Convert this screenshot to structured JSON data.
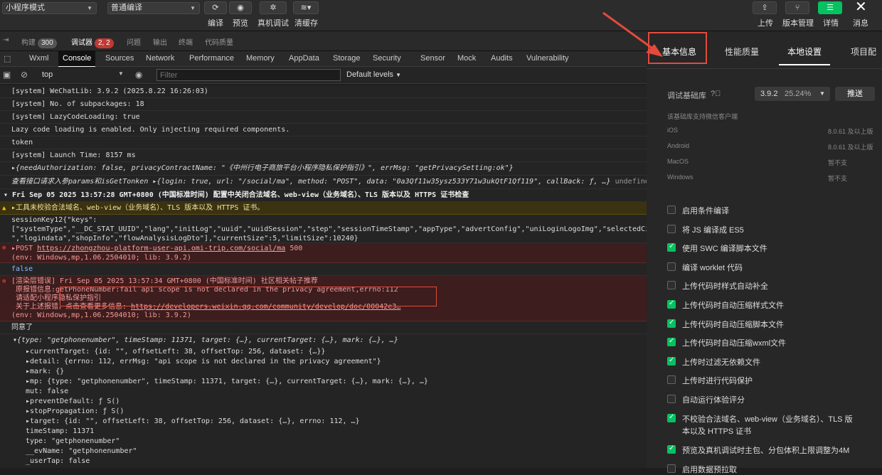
{
  "toolbar": {
    "mode_select": "小程序模式",
    "compile_select": "普通编译",
    "labels": {
      "compile": "编译",
      "preview": "预览",
      "remote_debug": "真机调试",
      "clear_cache": "清缓存",
      "upload": "上传",
      "version": "版本管理",
      "details": "详情",
      "messages": "消息"
    }
  },
  "tabs1": {
    "build": "构建",
    "build_count": "300",
    "debugger": "调试器",
    "debugger_count": "2, 2",
    "issues": "问题",
    "output": "输出",
    "terminal": "终端",
    "code_quality": "代码质量"
  },
  "tabs2": [
    "Wxml",
    "Console",
    "Sources",
    "Network",
    "Performance",
    "Memory",
    "AppData",
    "Storage",
    "Security",
    "Sensor",
    "Mock",
    "Audits",
    "Vulnerability"
  ],
  "filterbar": {
    "context": "top",
    "filter_placeholder": "Filter",
    "levels": "Default levels"
  },
  "console": {
    "l1": "[system] WeChatLib: 3.9.2 (2025.8.22 16:26:03)",
    "l2": "[system] No. of subpackages: 18",
    "l3": "[system] LazyCodeLoading: true",
    "l4": "Lazy code loading is enabled. Only injecting required components.",
    "l5": "token",
    "l6": "[system] Launch Time: 8157 ms",
    "l7": "▸{needAuthorization: false, privacyContractName: \"《中州行电子商旅平台小程序隐私保护指引》\", errMsg: \"getPrivacySetting:ok\"}",
    "l8": "查看接口请求入参params和isGetTonken ▸{login: true, url: \"/social/ma\", method: \"POST\", data: \"0a3Qf11w35ysz533Y71w3ukQtF1Qf119\", callBack: ƒ, …}",
    "l8_tail": "undefined",
    "l9": "▾ Fri Sep 05 2025 13:57:28 GMT+0800 (中国标准时间) 配置中关闭合法域名、web-view（业务域名）、TLS 版本以及 HTTPS 证书检查",
    "l10": "▸工具未校验合法域名、web-view（业务域名）、TLS 版本以及 HTTPS 证书。",
    "l11a": "sessionKey12{\"keys\":",
    "l11b": "[\"systemType\",\"__DC_STAT_UUID\",\"lang\",\"initLog\",\"uuid\",\"uuidSession\",\"step\",\"sessionTimeStamp\",\"appType\",\"advertConfig\",\"uniLoginLogoImg\",\"selectedCity\",",
    "l11c": "\",\"logindata\",\"shopInfo\",\"flowAnalysisLogDto\"],\"currentSize\":5,\"limitSize\":10240}",
    "l12a_pre": "▸POST ",
    "l12a_link": "https://zhongzhou-platform-user-api.omi-trip.com/social/ma",
    "l12a_code": " 500",
    "l12b": "(env: Windows,mp,1.06.2504010; lib: 3.9.2)",
    "l13": "false",
    "l14a": "[渲染层错误] Fri Sep 05 2025 13:57:34 GMT+0800 (中国标准时间) 社区相关帖子推荐",
    "l14b_pre": "原报错信息:",
    "l14b": "getPhoneNumber:fail api scope is not declared in the privacy agreement,errno:112",
    "l14c": "请适配小程序隐私保护指引",
    "l14d_pre": "关于上述报错，点击查看更多信息: ",
    "l14d_link": "https://developers.weixin.qq.com/community/develop/doc/00042e3…",
    "l14e": "(env: Windows,mp,1.06.2504010; lib: 3.9.2)",
    "l15": "同意了",
    "l16": "▾{type: \"getphonenumber\", timeStamp: 11371, target: {…}, currentTarget: {…}, mark: {…}, …}",
    "props": [
      "▸currentTarget: {id: \"\", offsetLeft: 38, offsetTop: 256, dataset: {…}}",
      "▸detail: {errno: 112, errMsg: \"api scope is not declared in the privacy agreement\"}",
      "▸mark: {}",
      "▸mp: {type: \"getphonenumber\", timeStamp: 11371, target: {…}, currentTarget: {…}, mark: {…}, …}",
      "  mut: false",
      "▸preventDefault: ƒ S()",
      "▸stopPropagation: ƒ S()",
      "▸target: {id: \"\", offsetLeft: 38, offsetTop: 256, dataset: {…}, errno: 112, …}",
      "  timeStamp: 11371",
      "  type: \"getphonenumber\"",
      "  __evName: \"getphonenumber\"",
      "  _userTap: false"
    ]
  },
  "panel": {
    "tabs": [
      "基本信息",
      "性能质量",
      "本地设置",
      "项目配"
    ],
    "lib_label": "调试基础库",
    "lib_version": "3.9.2",
    "lib_percent": "25.24%",
    "push_button": "推送",
    "support_title": "该基础库支持微信客户端",
    "platforms": [
      [
        "iOS",
        "8.0.61 及以上版"
      ],
      [
        "Android",
        "8.0.61 及以上版"
      ],
      [
        "MacOS",
        "暂不支"
      ],
      [
        "Windows",
        "暂不支"
      ]
    ],
    "options": [
      {
        "label": "启用条件编译",
        "on": false
      },
      {
        "label": "将 JS 编译成 ES5",
        "on": false
      },
      {
        "label": "使用 SWC 编译脚本文件",
        "on": true
      },
      {
        "label": "编译 worklet 代码",
        "on": false
      },
      {
        "label": "上传代码时样式自动补全",
        "on": false
      },
      {
        "label": "上传代码时自动压缩样式文件",
        "on": true
      },
      {
        "label": "上传代码时自动压缩脚本文件",
        "on": true
      },
      {
        "label": "上传代码时自动压缩wxml文件",
        "on": true
      },
      {
        "label": "上传时过滤无依赖文件",
        "on": true
      },
      {
        "label": "上传时进行代码保护",
        "on": false
      },
      {
        "label": "自动运行体验评分",
        "on": false
      },
      {
        "label": "不校验合法域名、web-view（业务域名）、TLS 版",
        "label2": "本以及 HTTPS 证书",
        "on": true
      },
      {
        "label": "预览及真机调试时主包、分包体积上限调整为4M",
        "on": true
      },
      {
        "label": "启用数据预拉取",
        "on": false
      }
    ]
  },
  "colors": {
    "accent": "#07c160",
    "error": "#e34a3c"
  }
}
